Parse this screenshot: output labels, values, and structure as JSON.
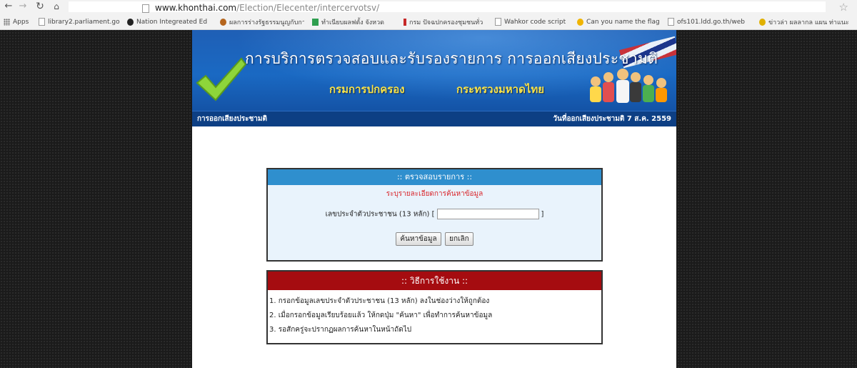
{
  "browser": {
    "url_host": "www.khonthai.com",
    "url_path": "/Election/Elecenter/intercervotsv/",
    "bookmarks": [
      {
        "label": "Apps",
        "icon": "apps-grid-icon"
      },
      {
        "label": "library2.parliament.go",
        "icon": "page-icon"
      },
      {
        "label": "Nation Integreated Ed",
        "icon": "nation-logo-icon"
      },
      {
        "label": "ผลการร่างรัฐธรรมนูญกับการ",
        "icon": "site-favicon"
      },
      {
        "label": "ทำเนียบผลฟตั้ง จังหวด",
        "icon": "site-favicon"
      },
      {
        "label": "กรม ปัจฉปกครองชุมชนทั่ว",
        "icon": "site-favicon"
      },
      {
        "label": "Wahkor code script",
        "icon": "page-icon"
      },
      {
        "label": "Can you name the flag",
        "icon": "quiz-favicon"
      },
      {
        "label": "ofs101.ldd.go.th/web",
        "icon": "page-icon"
      },
      {
        "label": "ข่าวล่า ผลลากล แผน ท่าแนะ",
        "icon": "site-favicon"
      }
    ]
  },
  "banner": {
    "title": "การบริการตรวจสอบและรับรองรายการ การออกเสียงประชามติ",
    "dept_left": "กรมการปกครอง",
    "dept_right": "กระทรวงมหาดไทย"
  },
  "subbar": {
    "left": "การออกเสียงประชามติ",
    "right": "วันที่ออกเสียงประชามติ 7 ส.ค. 2559"
  },
  "search": {
    "header": ":: ตรวจสอบรายการ ::",
    "hint": "ระบุรายละเอียดการค้นหาข้อมูล",
    "id_label": "เลขประจำตัวประชาชน (13 หลัก) [",
    "id_close": "]",
    "id_value": "",
    "search_button": "ค้นหาข้อมูล",
    "cancel_button": "ยกเลิก"
  },
  "howto": {
    "header": ":: วิธีการใช้งาน ::",
    "steps": [
      "1. กรอกข้อมูลเลขประจำตัวประชาชน (13 หลัก) ลงในช่องว่างให้ถูกต้อง",
      "2. เมื่อกรอกข้อมูลเรียบร้อยแล้ว ให้กดปุ่ม \"ค้นหา\" เพื่อทำการค้นหาข้อมูล",
      "3. รอสักครู่จะปรากฏผลการค้นหาในหน้าถัดไป"
    ]
  },
  "colors": {
    "banner_blue": "#1a69c3",
    "subbar_navy": "#0d3f84",
    "dept_yellow": "#f6e24a",
    "search_header": "#2f8fce",
    "search_bg": "#e9f3fc",
    "howto_header": "#a50c10",
    "hint_red": "#d9262b"
  }
}
